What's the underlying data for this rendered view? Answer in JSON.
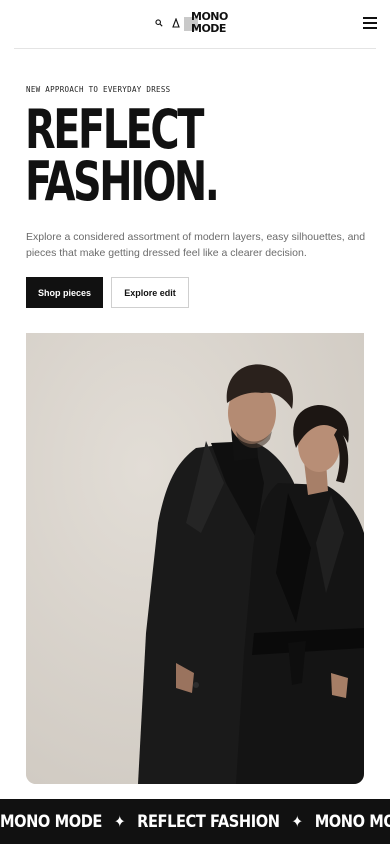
{
  "header": {
    "logo_line1": "MONO",
    "logo_line2": "MODE",
    "icons": [
      "search-icon",
      "user-icon",
      "bag-icon"
    ],
    "menu_icon": "hamburger-menu-icon"
  },
  "hero": {
    "eyebrow": "NEW APPROACH TO EVERYDAY DRESS",
    "title_line1": "REFLECT",
    "title_line2": "FASHION.",
    "description": "Explore a considered assortment of modern layers, easy silhouettes, and pieces that make getting dressed feel like a clearer decision.",
    "primary_button": "Shop pieces",
    "secondary_button": "Explore edit"
  },
  "marquee": {
    "item1": "MONO MODE",
    "item2": "REFLECT FASHION",
    "item3": "MONO MODE",
    "separator": "✦"
  },
  "colors": {
    "ink": "#111111",
    "muted": "#6b6b6b",
    "photo_background": "#d8d3cc",
    "rule": "#e4e4e4"
  }
}
